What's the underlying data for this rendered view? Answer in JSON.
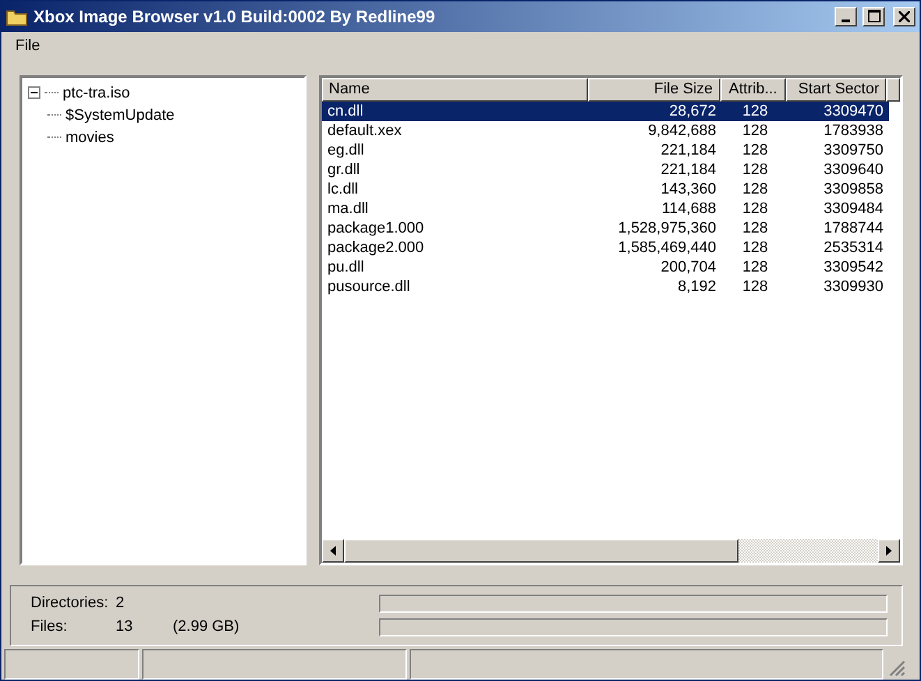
{
  "window": {
    "title": "Xbox Image Browser v1.0 Build:0002 By Redline99"
  },
  "menu": [
    "File"
  ],
  "tree": [
    {
      "label": "ptc-tra.iso",
      "expanded": true,
      "children": [
        {
          "label": "$SystemUpdate"
        },
        {
          "label": "movies"
        }
      ]
    }
  ],
  "table": {
    "columns": [
      {
        "label": "Name"
      },
      {
        "label": "File Size"
      },
      {
        "label": "Attrib..."
      },
      {
        "label": "Start Sector"
      }
    ],
    "rows": [
      {
        "cells": [
          "cn.dll",
          "28,672",
          "128",
          "3309470"
        ],
        "selected": true
      },
      {
        "cells": [
          "default.xex",
          "9,842,688",
          "128",
          "1783938"
        ],
        "selected": false
      },
      {
        "cells": [
          "eg.dll",
          "221,184",
          "128",
          "3309750"
        ],
        "selected": false
      },
      {
        "cells": [
          "gr.dll",
          "221,184",
          "128",
          "3309640"
        ],
        "selected": false
      },
      {
        "cells": [
          "lc.dll",
          "143,360",
          "128",
          "3309858"
        ],
        "selected": false
      },
      {
        "cells": [
          "ma.dll",
          "114,688",
          "128",
          "3309484"
        ],
        "selected": false
      },
      {
        "cells": [
          "package1.000",
          "1,528,975,360",
          "128",
          "1788744"
        ],
        "selected": false
      },
      {
        "cells": [
          "package2.000",
          "1,585,469,440",
          "128",
          "2535314"
        ],
        "selected": false
      },
      {
        "cells": [
          "pu.dll",
          "200,704",
          "128",
          "3309542"
        ],
        "selected": false
      },
      {
        "cells": [
          "pusource.dll",
          "8,192",
          "128",
          "3309930"
        ],
        "selected": false
      }
    ]
  },
  "stats": [
    {
      "label": "Directories:",
      "value": "2"
    },
    {
      "label": "Files:",
      "value": "13",
      "extra": "(2.99 GB)"
    }
  ],
  "progress": [
    {
      "level": 0
    },
    {
      "level": 0
    }
  ]
}
